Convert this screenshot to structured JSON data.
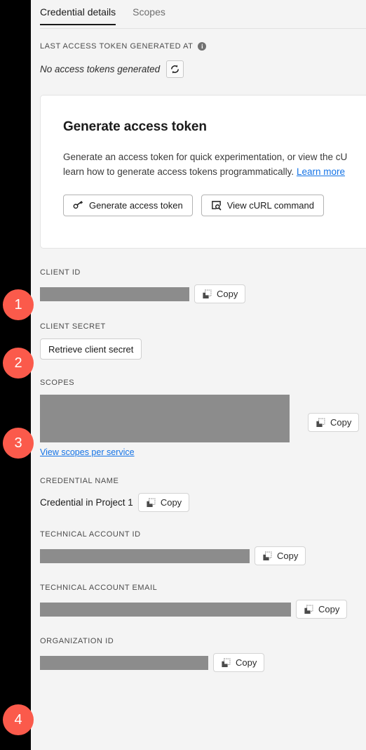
{
  "tabs": [
    {
      "label": "Credential details",
      "active": true
    },
    {
      "label": "Scopes",
      "active": false
    }
  ],
  "token_section": {
    "label": "LAST ACCESS TOKEN GENERATED AT",
    "info_icon": "info-icon",
    "info_glyph": "i",
    "status_text": "No access tokens generated",
    "refresh_icon": "refresh-icon"
  },
  "card": {
    "title": "Generate access token",
    "description_line1": "Generate an access token for quick experimentation, or view the cU",
    "description_line2": "learn how to generate access tokens programmatically.",
    "link_label": "Learn more",
    "generate_button": "Generate access token",
    "generate_icon": "key-icon",
    "curl_button": "View cURL command",
    "curl_icon": "code-inspect-icon"
  },
  "fields": {
    "client_id": {
      "label": "CLIENT ID",
      "value_redacted": true,
      "copy_label": "Copy",
      "copy_icon": "copy-icon"
    },
    "client_secret": {
      "label": "CLIENT SECRET",
      "button_label": "Retrieve client secret"
    },
    "scopes": {
      "label": "SCOPES",
      "value_redacted": true,
      "copy_label": "Copy",
      "copy_icon": "copy-icon",
      "link_label": "View scopes per service"
    },
    "credential_name": {
      "label": "CREDENTIAL NAME",
      "value": "Credential in Project 1",
      "copy_label": "Copy",
      "copy_icon": "copy-icon"
    },
    "technical_account_id": {
      "label": "TECHNICAL ACCOUNT ID",
      "value_redacted": true,
      "copy_label": "Copy",
      "copy_icon": "copy-icon"
    },
    "technical_account_email": {
      "label": "TECHNICAL ACCOUNT EMAIL",
      "value_redacted": true,
      "copy_label": "Copy",
      "copy_icon": "copy-icon"
    },
    "organization_id": {
      "label": "ORGANIZATION ID",
      "value_redacted": true,
      "copy_label": "Copy",
      "copy_icon": "copy-icon"
    }
  },
  "annotations": [
    {
      "number": "1",
      "target": "client-id"
    },
    {
      "number": "2",
      "target": "client-secret"
    },
    {
      "number": "3",
      "target": "scopes"
    },
    {
      "number": "4",
      "target": "organization-id"
    }
  ],
  "colors": {
    "badge": "#fb5a4b",
    "link": "#1473e6",
    "redaction": "#8c8c8c",
    "rail": "#000000",
    "background": "#f4f4f4"
  }
}
